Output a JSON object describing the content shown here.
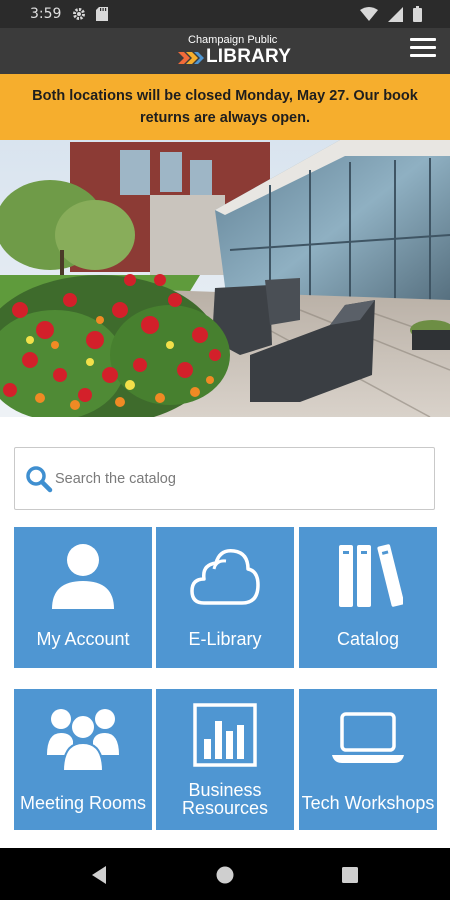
{
  "status_bar": {
    "time": "3:59",
    "left_icons": [
      "gear-icon",
      "sd-card-icon"
    ],
    "right_icons": [
      "wifi-icon",
      "signal-icon",
      "battery-icon"
    ]
  },
  "header": {
    "logo_top": "Champaign Public",
    "logo_main": "LIBRARY",
    "menu_icon": "hamburger-menu-icon"
  },
  "alert": {
    "text": "Both locations will be closed Monday, May 27. Our book returns are always open."
  },
  "search": {
    "placeholder": "Search the catalog",
    "value": ""
  },
  "tiles": [
    {
      "label": "My Account",
      "icon": "person-icon"
    },
    {
      "label": "E-Library",
      "icon": "cloud-icon"
    },
    {
      "label": "Catalog",
      "icon": "books-icon"
    },
    {
      "label": "Meeting Rooms",
      "icon": "group-icon"
    },
    {
      "label": "Business Resources",
      "label_line1": "Business",
      "label_line2": "Resources",
      "icon": "bar-chart-icon"
    },
    {
      "label": "Tech Workshops",
      "icon": "laptop-icon"
    }
  ],
  "nav": {
    "back": "back-icon",
    "home": "home-icon",
    "recents": "recents-icon"
  },
  "colors": {
    "header": "#3b3b3b",
    "alert": "#f6ae2d",
    "tile": "#4f96d2",
    "search_icon": "#3f8fd0"
  }
}
